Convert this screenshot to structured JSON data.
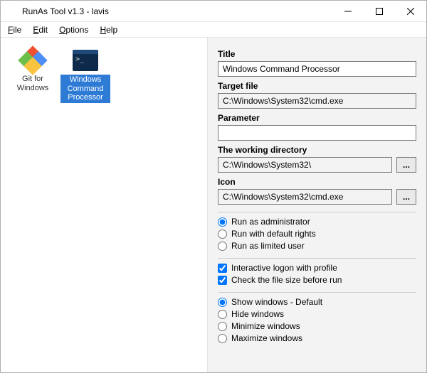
{
  "window": {
    "title": "RunAs Tool v1.3 - lavis"
  },
  "menus": {
    "file": "File",
    "edit": "Edit",
    "options": "Options",
    "help": "Help"
  },
  "items": {
    "git": "Git for Windows",
    "cmd": "Windows Command Processor"
  },
  "form": {
    "title_label": "Title",
    "title_value": "Windows Command Processor",
    "target_label": "Target file",
    "target_value": "C:\\Windows\\System32\\cmd.exe",
    "parameter_label": "Parameter",
    "parameter_value": "",
    "workdir_label": "The working directory",
    "workdir_value": "C:\\Windows\\System32\\",
    "icon_label": "Icon",
    "icon_value": "C:\\Windows\\System32\\cmd.exe",
    "browse": "..."
  },
  "rights": {
    "admin": "Run as administrator",
    "default": "Run with default rights",
    "limited": "Run as limited user"
  },
  "checks": {
    "interactive": "Interactive logon with profile",
    "filesize": "Check the file size before run"
  },
  "show": {
    "default": "Show windows - Default",
    "hide": "Hide windows",
    "min": "Minimize windows",
    "max": "Maximize windows"
  }
}
